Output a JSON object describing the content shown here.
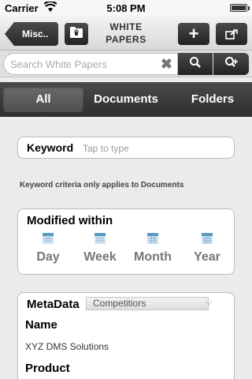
{
  "status_bar": {
    "carrier": "Carrier",
    "time": "5:08 PM"
  },
  "navbar": {
    "back_label": "Misc..",
    "title_line1": "WHITE",
    "title_line2": "PAPERS",
    "icons": {
      "folder": "folder-lock-icon",
      "add": "plus-icon",
      "share": "share-icon"
    },
    "add_label": "+"
  },
  "search": {
    "placeholder": "Search White Papers",
    "value": "",
    "clear_icon": "clear-x-icon",
    "search_icon": "search-icon",
    "advanced_icon": "search-plus-icon"
  },
  "tabs": [
    {
      "label": "All",
      "active": true
    },
    {
      "label": "Documents",
      "active": false
    },
    {
      "label": "Folders",
      "active": false
    }
  ],
  "keyword": {
    "label": "Keyword",
    "placeholder": "Tap to type",
    "note": "Keyword criteria only applies to Documents"
  },
  "modified": {
    "title": "Modified within",
    "periods": [
      {
        "label": "Day",
        "icon": "calendar-day-icon"
      },
      {
        "label": "Week",
        "icon": "calendar-week-icon"
      },
      {
        "label": "Month",
        "icon": "calendar-month-icon"
      },
      {
        "label": "Year",
        "icon": "calendar-year-icon"
      }
    ]
  },
  "metadata": {
    "title": "MetaData",
    "selected": "Competitiors",
    "name_label": "Name",
    "name_value": "XYZ DMS Solutions",
    "product_label": "Product"
  },
  "colors": {
    "dark_button": "#2e2e2e",
    "accent_calendar": "#4a8fb8"
  }
}
